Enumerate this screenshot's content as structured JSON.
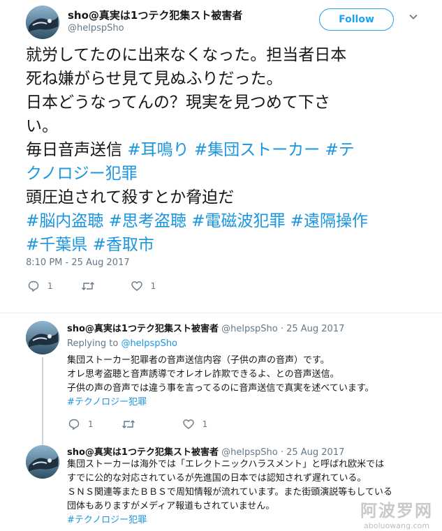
{
  "main_tweet": {
    "author_name": "sho@真実は1つテク犯集スト被害者",
    "handle": "@helpspSho",
    "follow_label": "Follow",
    "lines": [
      [
        {
          "t": "就労してたのに出来なくなった。担当者日本",
          "tag": false
        }
      ],
      [
        {
          "t": "死ね嫌がらせ見て見ぬふりだった。",
          "tag": false
        }
      ],
      [
        {
          "t": "日本どうなってんの？現実を見つめて下さ",
          "tag": false
        }
      ],
      [
        {
          "t": "い。",
          "tag": false
        }
      ],
      [
        {
          "t": "毎日音声送信 ",
          "tag": false
        },
        {
          "t": "#耳鳴り",
          "tag": true
        },
        {
          "t": " ",
          "tag": false
        },
        {
          "t": "#集団ストーカー",
          "tag": true
        },
        {
          "t": " ",
          "tag": false
        },
        {
          "t": "#テ",
          "tag": true
        }
      ],
      [
        {
          "t": "クノロジー犯罪",
          "tag": true
        }
      ],
      [
        {
          "t": "頭圧迫されて殺すとか脅迫だ",
          "tag": false
        }
      ],
      [
        {
          "t": "#脳内盗聴",
          "tag": true
        },
        {
          "t": " ",
          "tag": false
        },
        {
          "t": "#思考盗聴",
          "tag": true
        },
        {
          "t": " ",
          "tag": false
        },
        {
          "t": "#電磁波犯罪",
          "tag": true
        },
        {
          "t": " ",
          "tag": false
        },
        {
          "t": "#遠隔操作",
          "tag": true
        }
      ],
      [
        {
          "t": "#千葉県",
          "tag": true
        },
        {
          "t": " ",
          "tag": false
        },
        {
          "t": "#香取市",
          "tag": true
        }
      ]
    ],
    "timestamp": "8:10 PM - 25 Aug 2017",
    "reply_count": "1",
    "retweet_count": "",
    "like_count": "1"
  },
  "replies": [
    {
      "author_name": "sho@真実は1つテク犯集スト被害者",
      "meta": " @helpspSho · 25 Aug 2017",
      "replying_prefix": "Replying to ",
      "replying_handle": "@helpspSho",
      "lines": [
        "集団ストーカー犯罪者の音声送信内容（子供の声の音声）です。",
        "オレ思考盗聴と音声誘導でオレオレ詐欺できるよ、との音声送信。",
        "子供の声の音声では違う事を言ってるのに音声送信で真実を述べています。"
      ],
      "hashtag": "#テクノロジー犯罪",
      "reply_count": "1",
      "retweet_count": "",
      "like_count": "1"
    },
    {
      "author_name": "sho@真実は1つテク犯集スト被害者",
      "meta": " @helpspSho · 25 Aug 2017",
      "lines": [
        "集団ストーカーは海外では「エレクトニックハラスメント」と呼ばれ欧米では",
        "すでに公的な対応されているが先進国の日本では認知されず遅れている。",
        "ＳＮＳ関連等またＢＢＳで周知情報が流れています。また街頭演説等もしている",
        "団体もありますがメディア報道もされていません。"
      ],
      "hashtag": "#テクノロジー犯罪"
    }
  ],
  "watermark": {
    "main": "阿波罗网",
    "sub": "aboluowang.com"
  },
  "colors": {
    "link": "#1b95e0",
    "accent": "#1da1f2",
    "muted": "#657786"
  }
}
